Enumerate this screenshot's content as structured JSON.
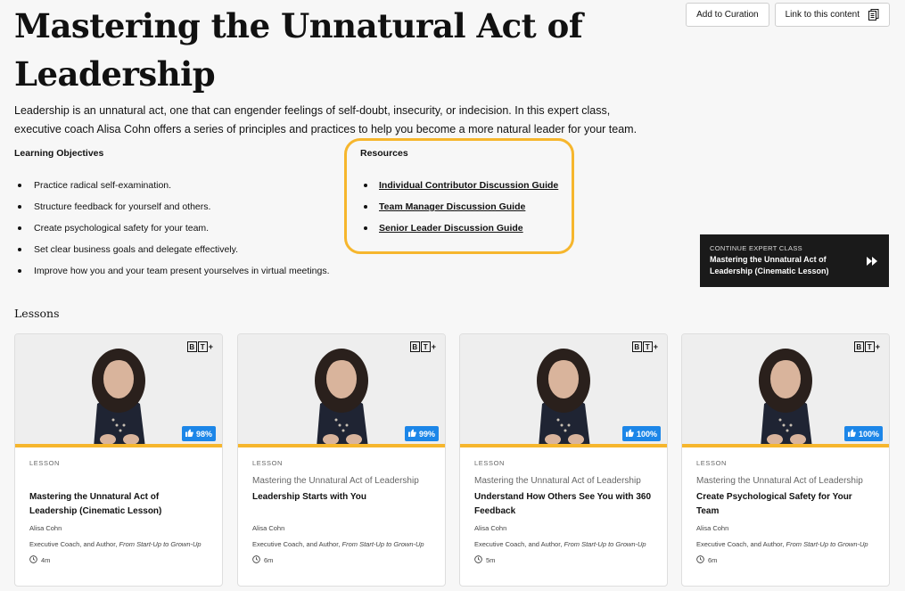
{
  "page": {
    "title": "Mastering the Unnatural Act of Leadership",
    "description": "Leadership is an unnatural act, one that can engender feelings of self-doubt, insecurity, or indecision. In this expert class, executive coach Alisa Cohn offers a series of principles and practices to help you become a more natural leader for your team."
  },
  "toolbar": {
    "add_to_curation": "Add to Curation",
    "link_to_content": "Link to this content"
  },
  "objectives": {
    "heading": "Learning Objectives",
    "items": [
      "Practice radical self-examination.",
      "Structure feedback for yourself and others.",
      "Create psychological safety for your team.",
      "Set clear business goals and delegate effectively.",
      "Improve how you and your team present yourselves in virtual meetings."
    ]
  },
  "resources": {
    "heading": "Resources",
    "items": [
      "Individual Contributor Discussion Guide",
      "Team Manager Discussion Guide",
      "Senior Leader Discussion Guide"
    ],
    "highlight_color": "#f6b62d"
  },
  "continue": {
    "kicker": "CONTINUE EXPERT CLASS",
    "title": "Mastering the Unnatural Act of Leadership (Cinematic Lesson)"
  },
  "lessons": {
    "heading": "Lessons",
    "logo": "B T +",
    "cards": [
      {
        "label": "LESSON",
        "parent": "",
        "title": "Mastering the Unnatural Act of Leadership (Cinematic Lesson)",
        "author": "Alisa Cohn",
        "role": "Executive Coach, and Author, ",
        "role_italic": "From Start-Up to Grown-Up",
        "duration": "4m",
        "rating": "98%"
      },
      {
        "label": "LESSON",
        "parent": "Mastering the Unnatural Act of Leadership",
        "title": "Leadership Starts with You",
        "author": "Alisa Cohn",
        "role": "Executive Coach, and Author, ",
        "role_italic": "From Start-Up to Grown-Up",
        "duration": "6m",
        "rating": "99%"
      },
      {
        "label": "LESSON",
        "parent": "Mastering the Unnatural Act of Leadership",
        "title": "Understand How Others See You with 360 Feedback",
        "author": "Alisa Cohn",
        "role": "Executive Coach, and Author, ",
        "role_italic": "From Start-Up to Grown-Up",
        "duration": "5m",
        "rating": "100%"
      },
      {
        "label": "LESSON",
        "parent": "Mastering the Unnatural Act of Leadership",
        "title": "Create Psychological Safety for Your Team",
        "author": "Alisa Cohn",
        "role": "Executive Coach, and Author, ",
        "role_italic": "From Start-Up to Grown-Up",
        "duration": "6m",
        "rating": "100%"
      }
    ]
  },
  "colors": {
    "accent": "#f6b62d",
    "rating_badge": "#1c86e8",
    "continue_bg": "#1a1a1a"
  }
}
